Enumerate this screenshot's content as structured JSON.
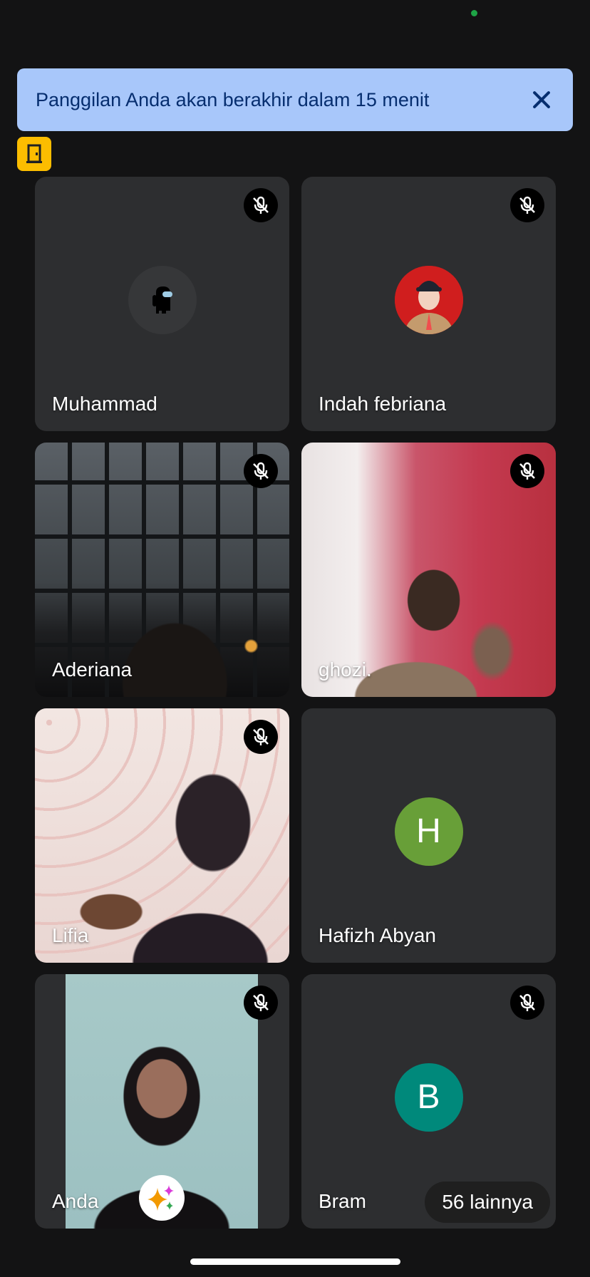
{
  "banner": {
    "message": "Panggilan Anda akan berakhir dalam 15 menit",
    "close_icon": "close-icon",
    "background": "#a8c7fa",
    "text_color": "#062e6f"
  },
  "room_badge": {
    "icon": "door-icon",
    "color": "#fcbd00"
  },
  "participants": [
    {
      "name": "Muhammad",
      "muted": true,
      "avatar": "astronaut-icon"
    },
    {
      "name": "Indah febriana",
      "muted": true,
      "avatar": "profile-photo"
    },
    {
      "name": "Aderiana",
      "muted": true,
      "video": true
    },
    {
      "name": "ghozi.",
      "muted": true,
      "video": true
    },
    {
      "name": "Lifia",
      "muted": true,
      "video": true
    },
    {
      "name": "Hafizh Abyan",
      "muted": false,
      "initial": "H",
      "color": "#689f38"
    },
    {
      "name": "Anda",
      "muted": true,
      "video": true,
      "effects_icon": "sparkle-icon"
    },
    {
      "name": "Bram",
      "muted": true,
      "initial": "B",
      "color": "#00897b"
    }
  ],
  "more_participants": "56 lainnya",
  "mute_icon": "mic-off-icon"
}
